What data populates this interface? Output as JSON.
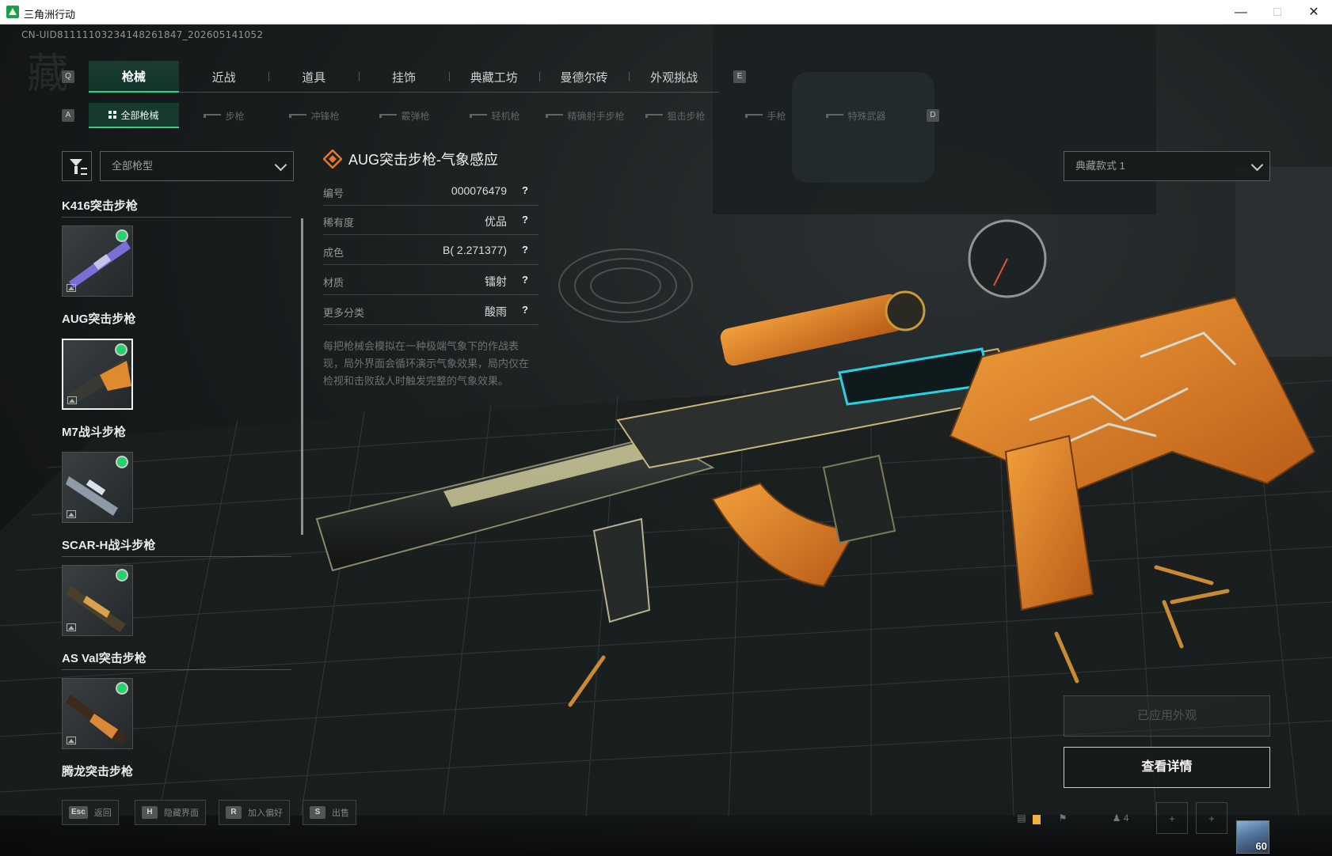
{
  "window": {
    "title": "三角洲行动"
  },
  "uid": "CN-UID8111110323414826184​7_202605141052",
  "watermark_glyph": "藏",
  "key_hints": {
    "tabs_prev": "Q",
    "tabs_next": "E",
    "sub_prev": "A",
    "sub_next": "D"
  },
  "tabs": [
    {
      "label": "枪械",
      "active": true
    },
    {
      "label": "近战",
      "active": false
    },
    {
      "label": "道具",
      "active": false
    },
    {
      "label": "挂饰",
      "active": false
    },
    {
      "label": "典藏工坊",
      "active": false
    },
    {
      "label": "曼德尔砖",
      "active": false
    },
    {
      "label": "外观挑战",
      "active": false
    }
  ],
  "sub_tabs": [
    {
      "label": "全部枪械",
      "active": true
    },
    {
      "label": "步枪",
      "active": false
    },
    {
      "label": "冲锋枪",
      "active": false
    },
    {
      "label": "霰弹枪",
      "active": false
    },
    {
      "label": "轻机枪",
      "active": false
    },
    {
      "label": "精确射手步枪",
      "active": false
    },
    {
      "label": "狙击步枪",
      "active": false
    },
    {
      "label": "手枪",
      "active": false
    },
    {
      "label": "特殊武器",
      "active": false
    }
  ],
  "filter": {
    "gun_type_value": "全部枪型"
  },
  "style_select": {
    "value": "典藏款式 1"
  },
  "gun_list": [
    {
      "name": "K416突击步枪",
      "selected": false,
      "equipped": true
    },
    {
      "name": "AUG突击步枪",
      "selected": true,
      "equipped": true
    },
    {
      "name": "M7战斗步枪",
      "selected": false,
      "equipped": true
    },
    {
      "name": "SCAR-H战斗步枪",
      "selected": false,
      "equipped": true
    },
    {
      "name": "AS Val突击步枪",
      "selected": false,
      "equipped": true
    },
    {
      "name": "腾龙突击步枪",
      "selected": false,
      "equipped": false
    }
  ],
  "detail": {
    "title": "AUG突击步枪-气象感应",
    "attributes": [
      {
        "key": "编号",
        "value": "000076479"
      },
      {
        "key": "稀有度",
        "value": "优品"
      },
      {
        "key": "成色",
        "value": "B( 2.271377)"
      },
      {
        "key": "材质",
        "value": "镭射"
      },
      {
        "key": "更多分类",
        "value": "酸雨"
      }
    ],
    "lore": "每把枪械会模拟在一种极端气象下的作战表现，局外界面会循环演示气象效果，局内仅在检视和击败敌人时触发完整的气象效果。"
  },
  "buttons": {
    "applied": "已应用外观",
    "view_details": "查看详情"
  },
  "bottom_hints": [
    {
      "key": "Esc",
      "label": "返回"
    },
    {
      "key": "H",
      "label": "隐藏界面"
    },
    {
      "key": "R",
      "label": "加入偏好"
    },
    {
      "key": "S",
      "label": "出售"
    }
  ],
  "tray": {
    "party_count": "4",
    "player_level": "60"
  },
  "colors": {
    "accent": "#2fd184",
    "equipped_dot": "#22d36e",
    "rarity_orange": "#e8762a"
  }
}
